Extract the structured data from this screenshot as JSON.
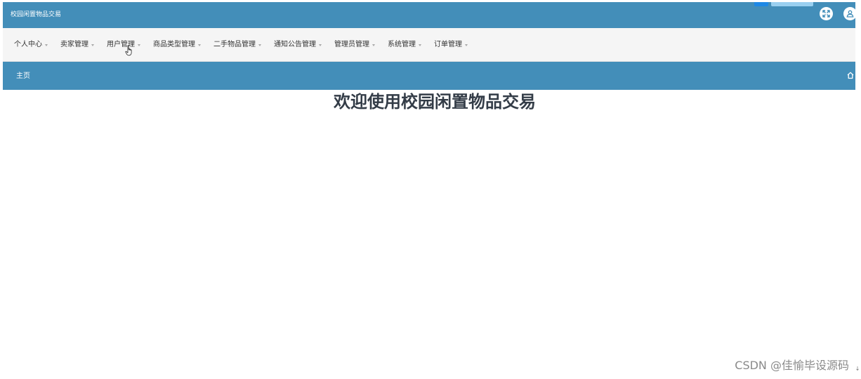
{
  "header": {
    "title": "校园闲置物品交易",
    "fullscreen_icon": "fullscreen-icon",
    "user_icon": "user-icon",
    "bg_color": "#438eb9"
  },
  "menu": {
    "items": [
      {
        "label": "个人中心"
      },
      {
        "label": "卖家管理"
      },
      {
        "label": "用户管理"
      },
      {
        "label": "商品类型管理"
      },
      {
        "label": "二手物品管理"
      },
      {
        "label": "通知公告管理"
      },
      {
        "label": "管理员管理"
      },
      {
        "label": "系统管理"
      },
      {
        "label": "订单管理"
      }
    ]
  },
  "breadcrumb": {
    "current": "主页",
    "home_icon": "home-icon"
  },
  "main": {
    "welcome_title": "欢迎使用校园闲置物品交易"
  },
  "watermark": {
    "text": "CSDN @佳愉毕设源码"
  }
}
